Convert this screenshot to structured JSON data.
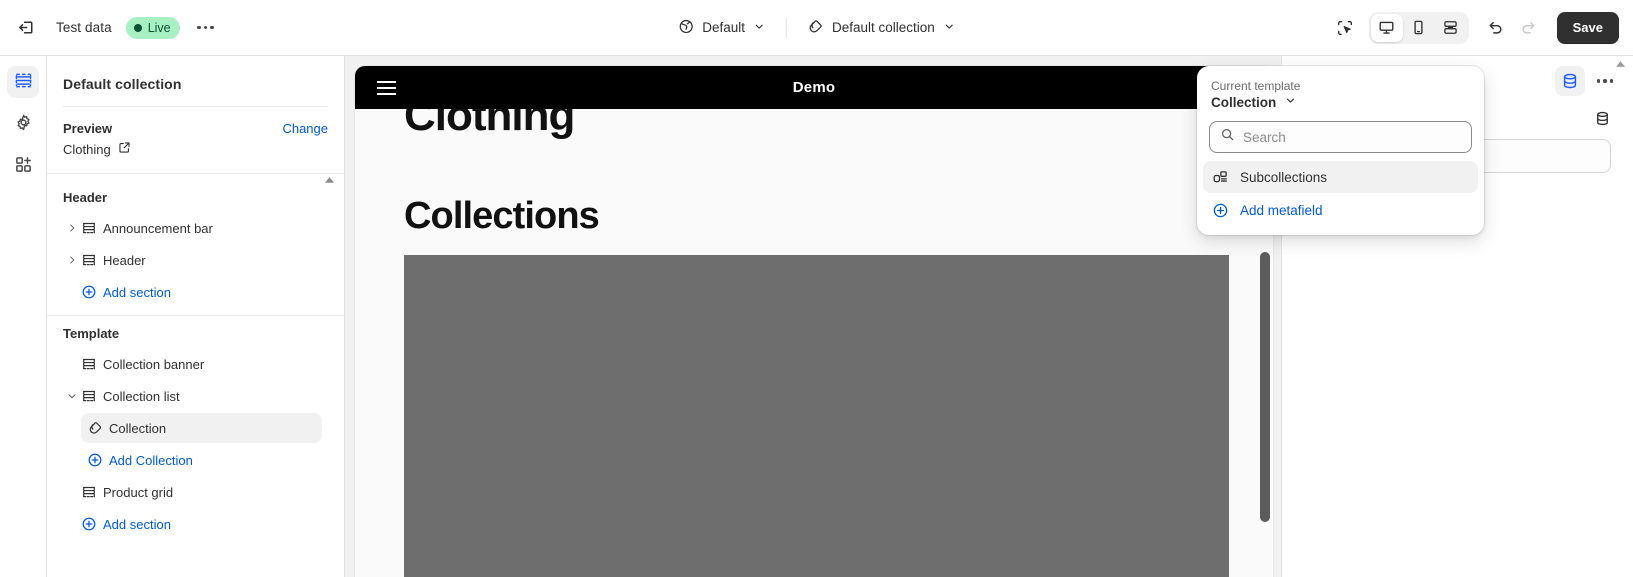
{
  "topbar": {
    "exit_icon": "exit-icon",
    "store_name": "Test data",
    "status_badge": "Live",
    "more_label": "more-actions",
    "theme_selector": {
      "icon": "globe-icon",
      "label": "Default"
    },
    "template_selector": {
      "icon": "collection-tag-icon",
      "label": "Default collection"
    },
    "inspector_icon": "select-element-icon",
    "devices": [
      {
        "name": "desktop",
        "icon": "desktop-icon",
        "active": true
      },
      {
        "name": "mobile",
        "icon": "mobile-icon",
        "active": false
      },
      {
        "name": "fullscreen",
        "icon": "fullscreen-icon",
        "active": false
      }
    ],
    "undo_icon": "undo-icon",
    "redo_icon": "redo-icon",
    "save_label": "Save",
    "accent_color": "#005bd3",
    "save_bg": "#303030",
    "live_bg": "#a6f0c4",
    "live_fg": "#0c5132"
  },
  "rail": [
    {
      "name": "sections",
      "icon": "sections-icon",
      "active": true
    },
    {
      "name": "theme-settings",
      "icon": "gear-icon",
      "active": false
    },
    {
      "name": "apps",
      "icon": "apps-add-icon",
      "active": false
    }
  ],
  "sidebar": {
    "title": "Default collection",
    "preview": {
      "label": "Preview",
      "change_label": "Change",
      "value": "Clothing",
      "external_icon": "external-link-icon"
    },
    "groups": [
      {
        "title": "Header",
        "items": [
          {
            "label": "Announcement bar",
            "icon": "section-icon",
            "caret": "chevron-right",
            "selected": false,
            "indent": false
          },
          {
            "label": "Header",
            "icon": "section-icon",
            "caret": "chevron-right",
            "selected": false,
            "indent": false
          }
        ],
        "add_label": "Add section",
        "add_icon": "circle-plus-icon"
      },
      {
        "title": "Template",
        "items": [
          {
            "label": "Collection banner",
            "icon": "section-icon",
            "caret": "none",
            "selected": false,
            "indent": false
          },
          {
            "label": "Collection list",
            "icon": "section-icon",
            "caret": "chevron-down",
            "selected": false,
            "indent": false
          },
          {
            "label": "Collection",
            "icon": "collection-tag-icon",
            "caret": "none",
            "selected": true,
            "indent": true
          }
        ],
        "sub_add_label": "Add Collection",
        "sub_add_icon": "circle-plus-icon",
        "items_after": [
          {
            "label": "Product grid",
            "icon": "section-icon",
            "caret": "none",
            "selected": false,
            "indent": false
          }
        ],
        "add_label": "Add section",
        "add_icon": "circle-plus-icon"
      }
    ]
  },
  "preview": {
    "header": {
      "menu_icon": "hamburger-icon",
      "title": "Demo",
      "search_icon": "search-icon",
      "bg": "#000000",
      "fg": "#ffffff"
    },
    "clipped_heading": "Clothing",
    "heading": "Collections",
    "placeholder_color": "#6e6e6e",
    "page_bg": "#fafafa"
  },
  "right_panel": {
    "metafield_icon": "metafield-database-icon",
    "more_icon": "more-actions-icon",
    "database_icon": "database-icon"
  },
  "popover": {
    "kicker": "Current template",
    "current_template": "Collection",
    "chevron_icon": "chevron-down-icon",
    "search": {
      "icon": "search-icon",
      "placeholder": "Search",
      "value": ""
    },
    "items": [
      {
        "label": "Subcollections",
        "icon": "metaobject-icon",
        "hovered": true
      }
    ],
    "add": {
      "label": "Add metafield",
      "icon": "circle-plus-icon"
    }
  }
}
